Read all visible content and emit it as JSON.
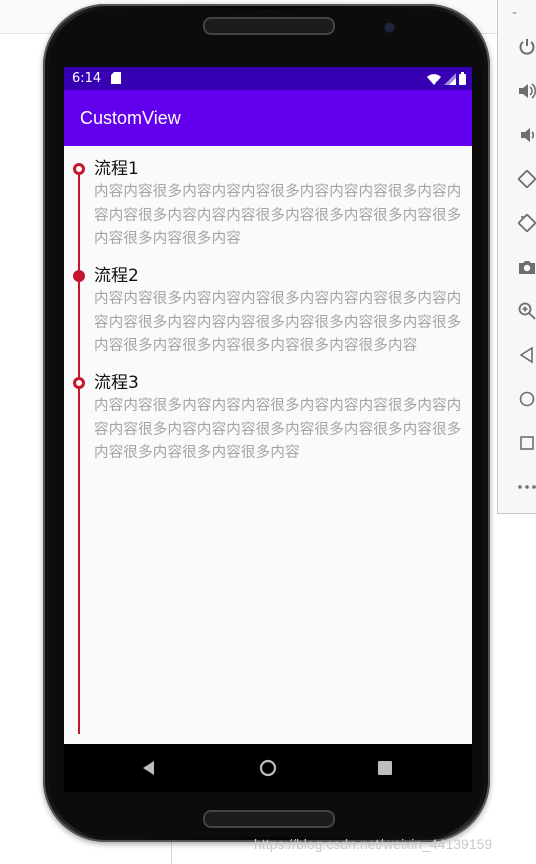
{
  "emulator": {
    "minimize_label": "-",
    "toolbar_icons": [
      "power-icon",
      "volume-up-icon",
      "volume-down-icon",
      "rotate-left-icon",
      "rotate-right-icon",
      "camera-icon",
      "zoom-icon",
      "back-icon",
      "home-icon",
      "overview-icon",
      "more-icon"
    ]
  },
  "status_bar": {
    "time": "6:14"
  },
  "app_bar": {
    "title": "CustomView"
  },
  "timeline": {
    "accent_color": "#c5162e",
    "steps": [
      {
        "title": "流程1",
        "content": "内容内容很多内容内容内容很多内容内容内容很多内容内容内容很多内容内容内容很多内容很多内容很多内容很多内容很多内容很多内容",
        "marker": "hollow"
      },
      {
        "title": "流程2",
        "content": "内容内容很多内容内容内容很多内容内容内容很多内容内容内容很多内容内容内容很多内容很多内容很多内容很多内容很多内容很多内容很多内容很多内容很多内容",
        "marker": "filled"
      },
      {
        "title": "流程3",
        "content": "内容内容很多内容内容内容很多内容内容内容很多内容内容内容很多内容内容内容很多内容很多内容很多内容很多内容很多内容很多内容很多内容",
        "marker": "hollow"
      }
    ]
  },
  "colors": {
    "status_bar": "#3700b3",
    "app_bar": "#6200ee"
  },
  "watermark": "https://blog.csdn.net/weixin_44139159"
}
